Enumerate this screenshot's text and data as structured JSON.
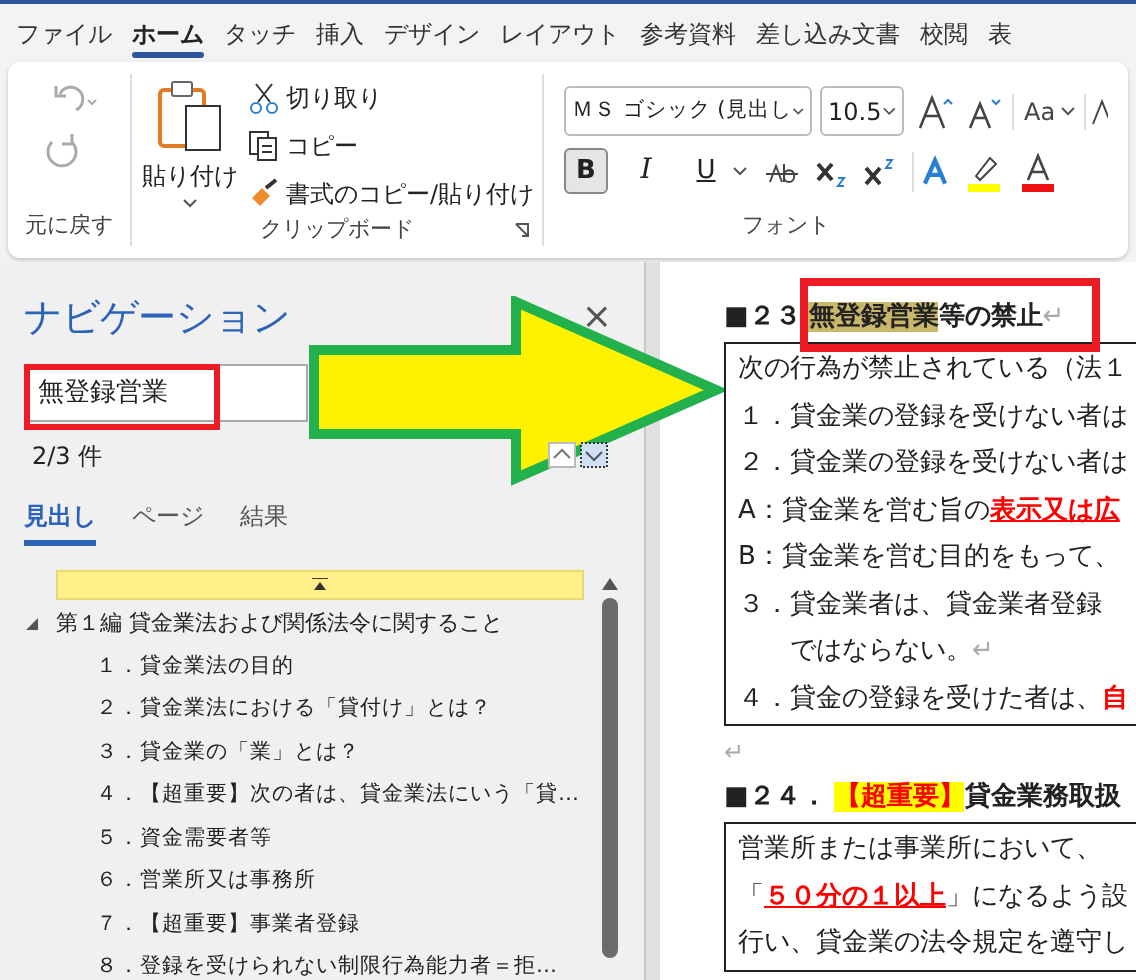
{
  "ribbon_tabs": [
    {
      "label": "ファイル",
      "selected": false
    },
    {
      "label": "ホーム",
      "selected": true
    },
    {
      "label": "タッチ",
      "selected": false
    },
    {
      "label": "挿入",
      "selected": false
    },
    {
      "label": "デザイン",
      "selected": false
    },
    {
      "label": "レイアウト",
      "selected": false
    },
    {
      "label": "参考資料",
      "selected": false
    },
    {
      "label": "差し込み文書",
      "selected": false
    },
    {
      "label": "校閲",
      "selected": false
    },
    {
      "label": "表",
      "selected": false
    }
  ],
  "ribbon": {
    "undo": {
      "label": "元に戻す"
    },
    "clipboard": {
      "paste": "貼り付け",
      "cut": "切り取り",
      "copy": "コピー",
      "format_painter": "書式のコピー/貼り付け",
      "label": "クリップボード"
    },
    "font": {
      "name": "ＭＳ ゴシック (見出し",
      "size": "10.5",
      "case_button": "Aa",
      "style_buttons": [
        {
          "label": "B",
          "kind": "bold",
          "on": true
        },
        {
          "label": "I",
          "kind": "italic",
          "on": false
        },
        {
          "label": "U",
          "kind": "underline",
          "on": false
        }
      ],
      "label": "フォント"
    }
  },
  "navigation": {
    "title": "ナビゲーション",
    "close": "×",
    "search_value": "無登録営業",
    "result_count": "2/3 件",
    "tabs": [
      {
        "label": "見出し",
        "selected": true
      },
      {
        "label": "ページ",
        "selected": false
      },
      {
        "label": "結果",
        "selected": false
      }
    ],
    "tree": [
      {
        "label": "第１編 貸金業法および関係法令に関すること",
        "expanded": true,
        "children": [
          {
            "label": "１．貸金業法の目的"
          },
          {
            "label": "２．貸金業法における「貸付け」とは？"
          },
          {
            "label": "３．貸金業の「業」とは？"
          },
          {
            "label": "４．【超重要】次の者は、貸金業法にいう「貸…"
          },
          {
            "label": "５．資金需要者等"
          },
          {
            "label": "６．営業所又は事務所"
          },
          {
            "label": "７．【超重要】事業者登録"
          },
          {
            "label": "８．登録を受けられない制限行為能力者＝拒…"
          }
        ]
      }
    ]
  },
  "document": {
    "sections": [
      {
        "number": "■２３",
        "heading": [
          {
            "text": "無登録営業",
            "kind": "search_hit"
          },
          {
            "text": "等の禁止",
            "kind": "plain"
          },
          {
            "text": "↵",
            "kind": "mark"
          }
        ],
        "lines": [
          {
            "indent": false,
            "segments": [
              {
                "text": "次の行為が禁止されている（法１",
                "kind": "plain"
              }
            ]
          },
          {
            "indent": false,
            "segments": [
              {
                "text": "１．貸金業の登録を受けない者は",
                "kind": "plain"
              }
            ]
          },
          {
            "indent": false,
            "segments": [
              {
                "text": "２．貸金業の登録を受けない者は",
                "kind": "plain"
              }
            ]
          },
          {
            "indent": false,
            "segments": [
              {
                "text": "A：貸金業を営む旨の",
                "kind": "plain"
              },
              {
                "text": "表示又は広",
                "kind": "emphasis"
              }
            ]
          },
          {
            "indent": false,
            "segments": [
              {
                "text": "B：貸金業を営む目的をもって、",
                "kind": "plain"
              }
            ]
          },
          {
            "indent": false,
            "segments": [
              {
                "text": "３．貸金業者は、貸金業者登録",
                "kind": "plain"
              }
            ]
          },
          {
            "indent": true,
            "segments": [
              {
                "text": "ではならない。",
                "kind": "plain"
              },
              {
                "text": "↵",
                "kind": "mark"
              }
            ]
          },
          {
            "indent": false,
            "segments": [
              {
                "text": "４．貸金の登録を受けた者は、",
                "kind": "plain"
              },
              {
                "text": "自",
                "kind": "emphasis_bold"
              }
            ]
          }
        ]
      },
      {
        "leading_mark": "↵",
        "number": "■２４．",
        "heading": [
          {
            "text": "【超重要】",
            "kind": "tag"
          },
          {
            "text": "貸金業務取扱",
            "kind": "plain"
          }
        ],
        "lines": [
          {
            "indent": false,
            "segments": [
              {
                "text": "営業所または事業所において、",
                "kind": "plain"
              }
            ]
          },
          {
            "indent": false,
            "segments": [
              {
                "text": "「",
                "kind": "plain"
              },
              {
                "text": "５０分の１以上",
                "kind": "emphasis"
              },
              {
                "text": "」になるよう設",
                "kind": "plain"
              }
            ]
          },
          {
            "indent": false,
            "segments": [
              {
                "text": "行い、貸金業の法令規定を遵守し",
                "kind": "plain"
              }
            ]
          }
        ]
      }
    ]
  }
}
